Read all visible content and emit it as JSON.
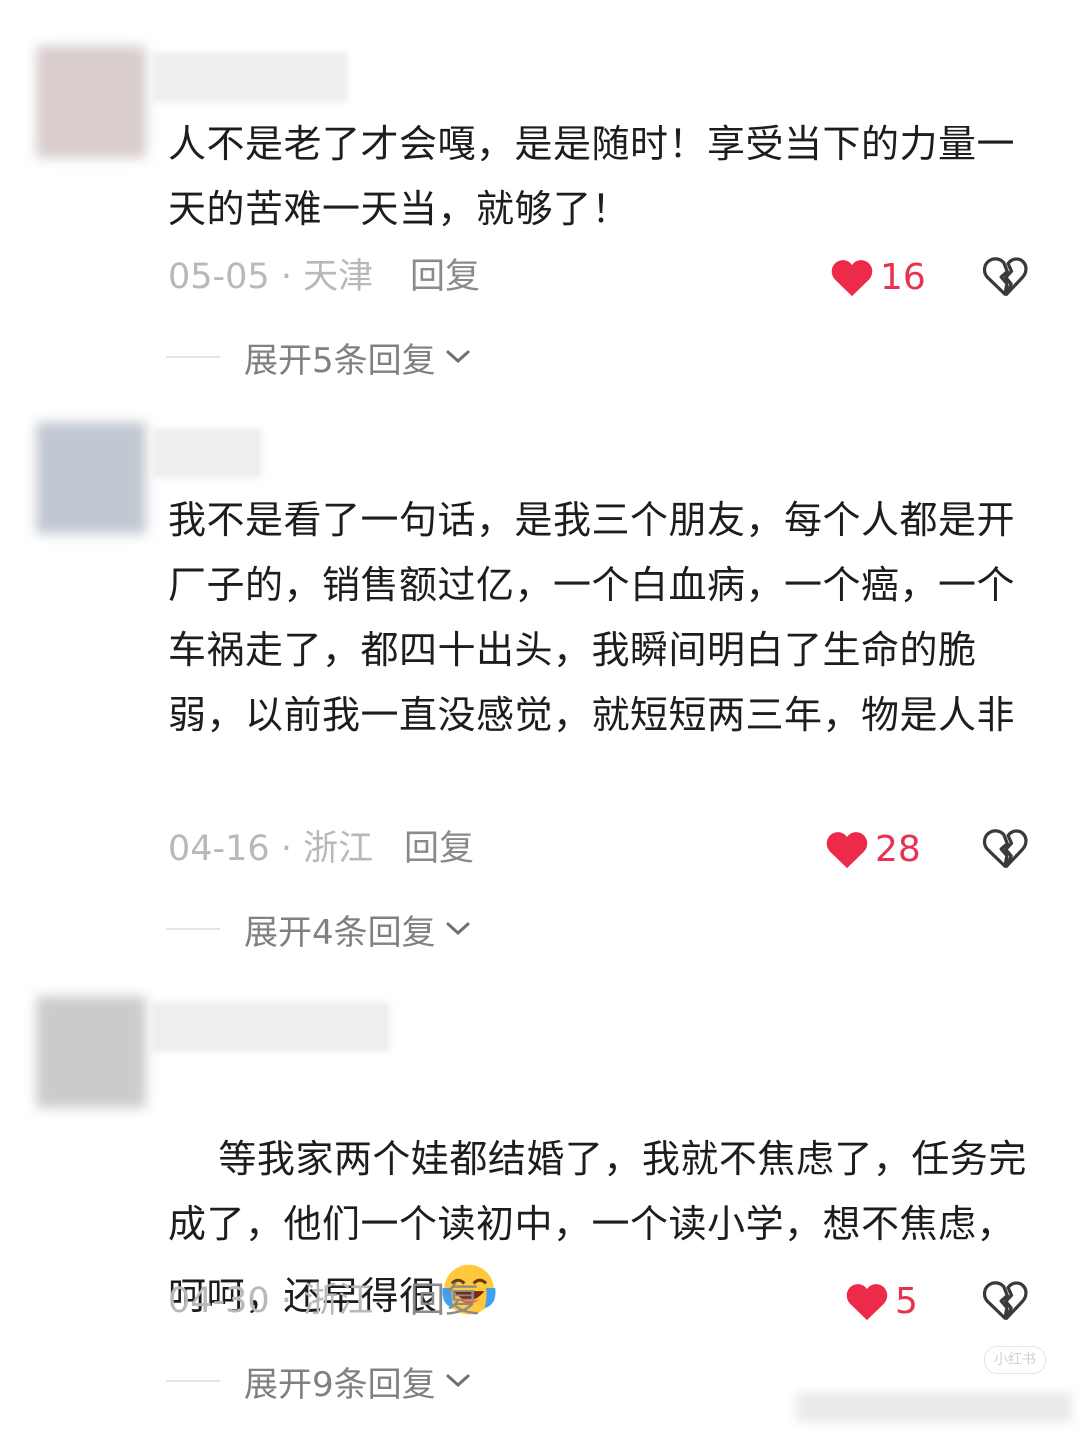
{
  "comments": [
    {
      "text": "人不是老了才会嘎，是是随时！享受当下的力量一天的苦难一天当，就够了！",
      "date_location": "05-05 · 天津",
      "reply_label": "回复",
      "likes": "16",
      "expand_label": "展开5条回复"
    },
    {
      "text": "我不是看了一句话，是我三个朋友，每个人都是开厂子的，销售额过亿，一个白血病，一个癌，一个车祸走了，都四十出头，我瞬间明白了生命的脆弱，以前我一直没感觉，就短短两三年，物是人非",
      "date_location": "04-16 · 浙江",
      "reply_label": "回复",
      "likes": "28",
      "expand_label": "展开4条回复"
    },
    {
      "text": "等我家两个娃都结婚了，我就不焦虑了，任务完成了，他们一个读初中，一个读小学，想不焦虑，呵呵，还早得很",
      "emoji": "laughing-crying-emoji",
      "date_location": "04-30 · 浙江",
      "reply_label": "回复",
      "likes": "5",
      "expand_label": "展开9条回复"
    }
  ],
  "watermark": "小红书",
  "colors": {
    "heart": "#ee2a4a",
    "like_count": "#e8334e",
    "meta": "#b8b8b8",
    "text": "#1d1d1d"
  }
}
